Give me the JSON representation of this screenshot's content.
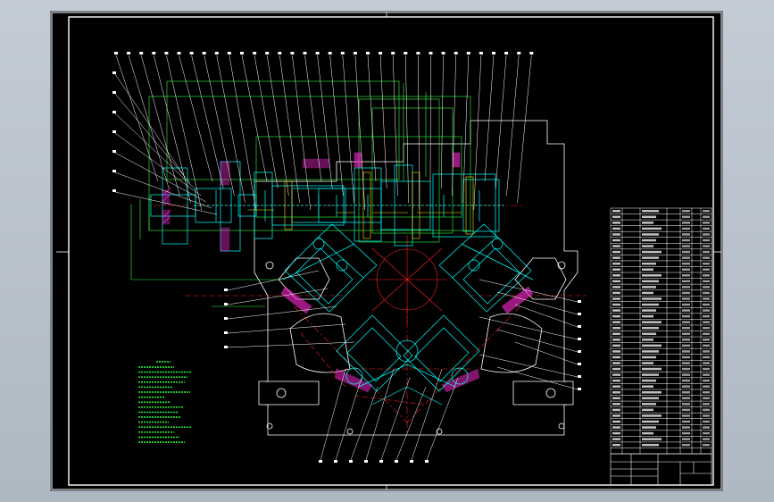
{
  "drawing": {
    "colors": {
      "background": "#000000",
      "frame": "#ffffff",
      "leader": "#ffffff",
      "centerline": "#ff2020",
      "section": "#00ffff",
      "hatch": "#ff2bd6",
      "dimension": "#2dff3a",
      "gear": "#ffe600",
      "notes": "#2dff3a"
    },
    "leader_count_top": 34,
    "leader_count_left": 7,
    "leader_count_right": 8,
    "leader_count_bottom": 8,
    "parts_list_rows": 42,
    "icons": [
      "drawing-frame",
      "title-block",
      "parts-list",
      "technical-notes",
      "gearbox-section"
    ]
  }
}
